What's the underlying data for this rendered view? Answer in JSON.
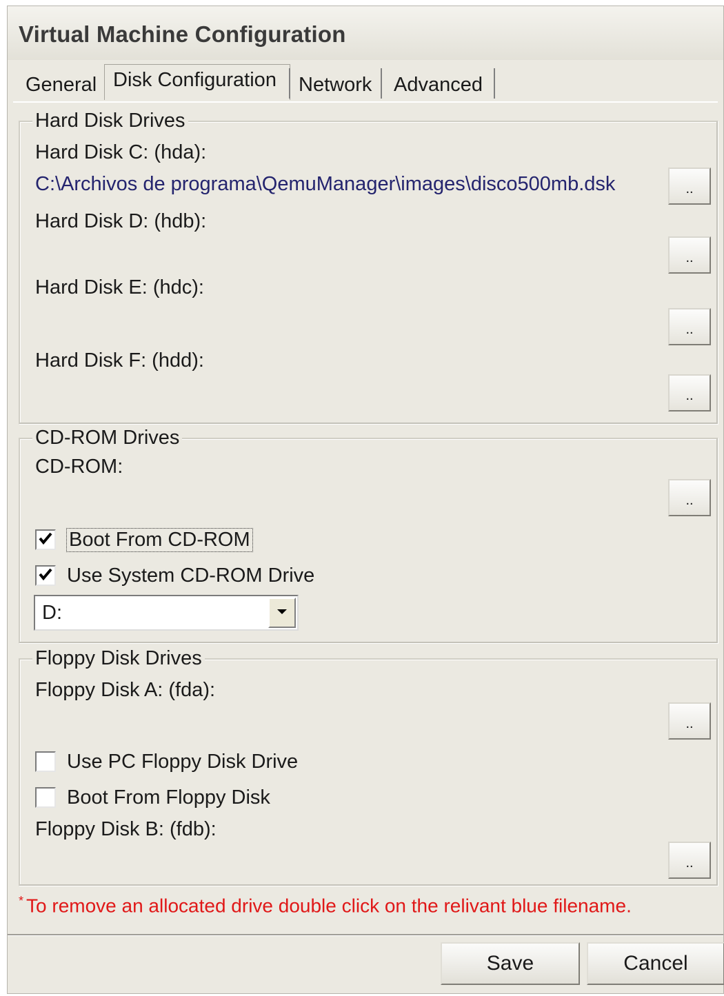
{
  "window": {
    "title": "Virtual Machine Configuration"
  },
  "tabs": [
    {
      "label": "General"
    },
    {
      "label": "Disk Configuration",
      "active": true
    },
    {
      "label": "Network"
    },
    {
      "label": "Advanced"
    }
  ],
  "hard_disks": {
    "legend": "Hard Disk Drives",
    "items": [
      {
        "label": "Hard Disk C: (hda):",
        "path": "C:\\Archivos de programa\\QemuManager\\images\\disco500mb.dsk"
      },
      {
        "label": "Hard Disk D: (hdb):",
        "path": ""
      },
      {
        "label": "Hard Disk E: (hdc):",
        "path": ""
      },
      {
        "label": "Hard Disk F: (hdd):",
        "path": ""
      }
    ],
    "browse_label": ".."
  },
  "cdrom": {
    "legend": "CD-ROM Drives",
    "label": "CD-ROM:",
    "browse_label": "..",
    "boot_from_cdrom": {
      "label": "Boot From CD-ROM",
      "checked": true
    },
    "use_system_drive": {
      "label": "Use System CD-ROM Drive",
      "checked": true
    },
    "drive_select": {
      "value": "D:"
    }
  },
  "floppy": {
    "legend": "Floppy Disk Drives",
    "drive_a_label": "Floppy Disk A: (fda):",
    "drive_b_label": "Floppy Disk B: (fdb):",
    "browse_label": "..",
    "use_pc_floppy": {
      "label": "Use PC Floppy Disk Drive",
      "checked": false
    },
    "boot_from_floppy": {
      "label": "Boot From Floppy Disk",
      "checked": false
    }
  },
  "note": {
    "star": "*",
    "text": "To remove an allocated drive double click on the relivant blue filename."
  },
  "buttons": {
    "save": "Save",
    "cancel": "Cancel"
  },
  "colors": {
    "path_text": "#24246e",
    "note_text": "#e01818",
    "window_bg": "#ebe9e1"
  }
}
